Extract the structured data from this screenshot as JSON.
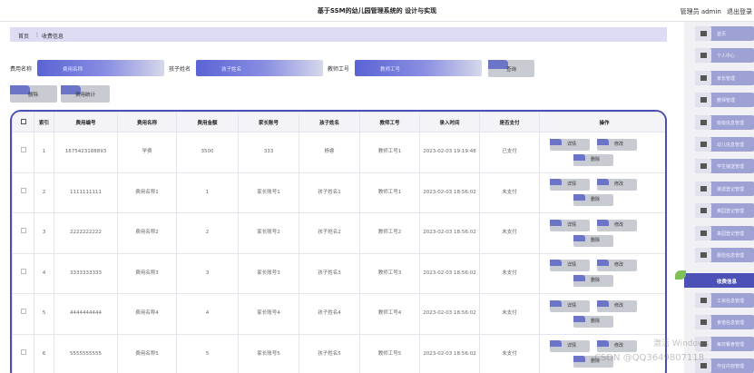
{
  "header": {
    "title": "基于SSM的幼儿园管理系统的 设计与实现",
    "user_label": "管理员 admin",
    "logout": "退出登录"
  },
  "breadcrumb": {
    "home": "首页",
    "sep": "⋮",
    "current": "收费信息"
  },
  "search": {
    "fee_name_label": "费用名称",
    "fee_name_placeholder": "费用名称",
    "child_name_label": "孩子姓名",
    "child_name_placeholder": "孩子姓名",
    "teacher_no_label": "教师工号",
    "teacher_no_placeholder": "教师工号",
    "query_button": "查询"
  },
  "toolbar": {
    "delete_button": "删除",
    "stats_button": "费用统计"
  },
  "table": {
    "headers": [
      "索引",
      "费用编号",
      "费用名称",
      "费用金额",
      "家长账号",
      "孩子姓名",
      "教师工号",
      "录入时间",
      "是否支付",
      "操作"
    ],
    "rows": [
      [
        "1",
        "1675423188893",
        "学费",
        "3500",
        "333",
        "杨睿",
        "教师工号1",
        "2023-02-03 19:19:48",
        "已支付"
      ],
      [
        "2",
        "1111111111",
        "费用名称1",
        "1",
        "家长账号1",
        "孩子姓名1",
        "教师工号1",
        "2023-02-03 18:56:02",
        "未支付"
      ],
      [
        "3",
        "2222222222",
        "费用名称2",
        "2",
        "家长账号2",
        "孩子姓名2",
        "教师工号2",
        "2023-02-03 18:56:02",
        "未支付"
      ],
      [
        "4",
        "3333333333",
        "费用名称3",
        "3",
        "家长账号3",
        "孩子姓名3",
        "教师工号3",
        "2023-02-03 18:56:02",
        "未支付"
      ],
      [
        "5",
        "4444444444",
        "费用名称4",
        "4",
        "家长账号4",
        "孩子姓名4",
        "教师工号4",
        "2023-02-03 18:56:02",
        "未支付"
      ],
      [
        "6",
        "5555555555",
        "费用名称5",
        "5",
        "家长账号5",
        "孩子姓名5",
        "教师工号5",
        "2023-02-03 18:56:02",
        "未支付"
      ]
    ],
    "ops": {
      "detail": "详情",
      "edit": "修改",
      "delete": "删除"
    }
  },
  "sidebar": {
    "items": [
      {
        "label": "首页",
        "icon": "home-icon"
      },
      {
        "label": "个人中心",
        "icon": "person-icon"
      },
      {
        "label": "家长管理",
        "icon": "card-icon"
      },
      {
        "label": "教师管理",
        "icon": "grid-icon"
      },
      {
        "label": "班级信息管理",
        "icon": "grid-icon"
      },
      {
        "label": "幼儿信息管理",
        "icon": "grid-icon"
      },
      {
        "label": "学生接送管理",
        "icon": "grid-icon"
      },
      {
        "label": "接送登记管理",
        "icon": "tag-icon"
      },
      {
        "label": "离园登记管理",
        "icon": "grid-icon"
      },
      {
        "label": "来园登记管理",
        "icon": "card-icon"
      },
      {
        "label": "晨检信息管理",
        "icon": "grid-icon"
      }
    ],
    "active": "收费信息",
    "sub_items": [
      {
        "label": "工资信息管理",
        "icon": "grid-icon"
      },
      {
        "label": "食谱信息管理",
        "icon": "person-icon"
      },
      {
        "label": "每日餐食管理",
        "icon": "grid-icon"
      },
      {
        "label": "作业内容管理",
        "icon": "grid-icon"
      }
    ]
  },
  "watermark": {
    "activate": "激活 Windows",
    "csdn": "CSDN @QQ3649807118"
  },
  "colors": {
    "accent": "#4c51b8",
    "button": "#c9cbd2",
    "tab": "#6c74c8"
  }
}
